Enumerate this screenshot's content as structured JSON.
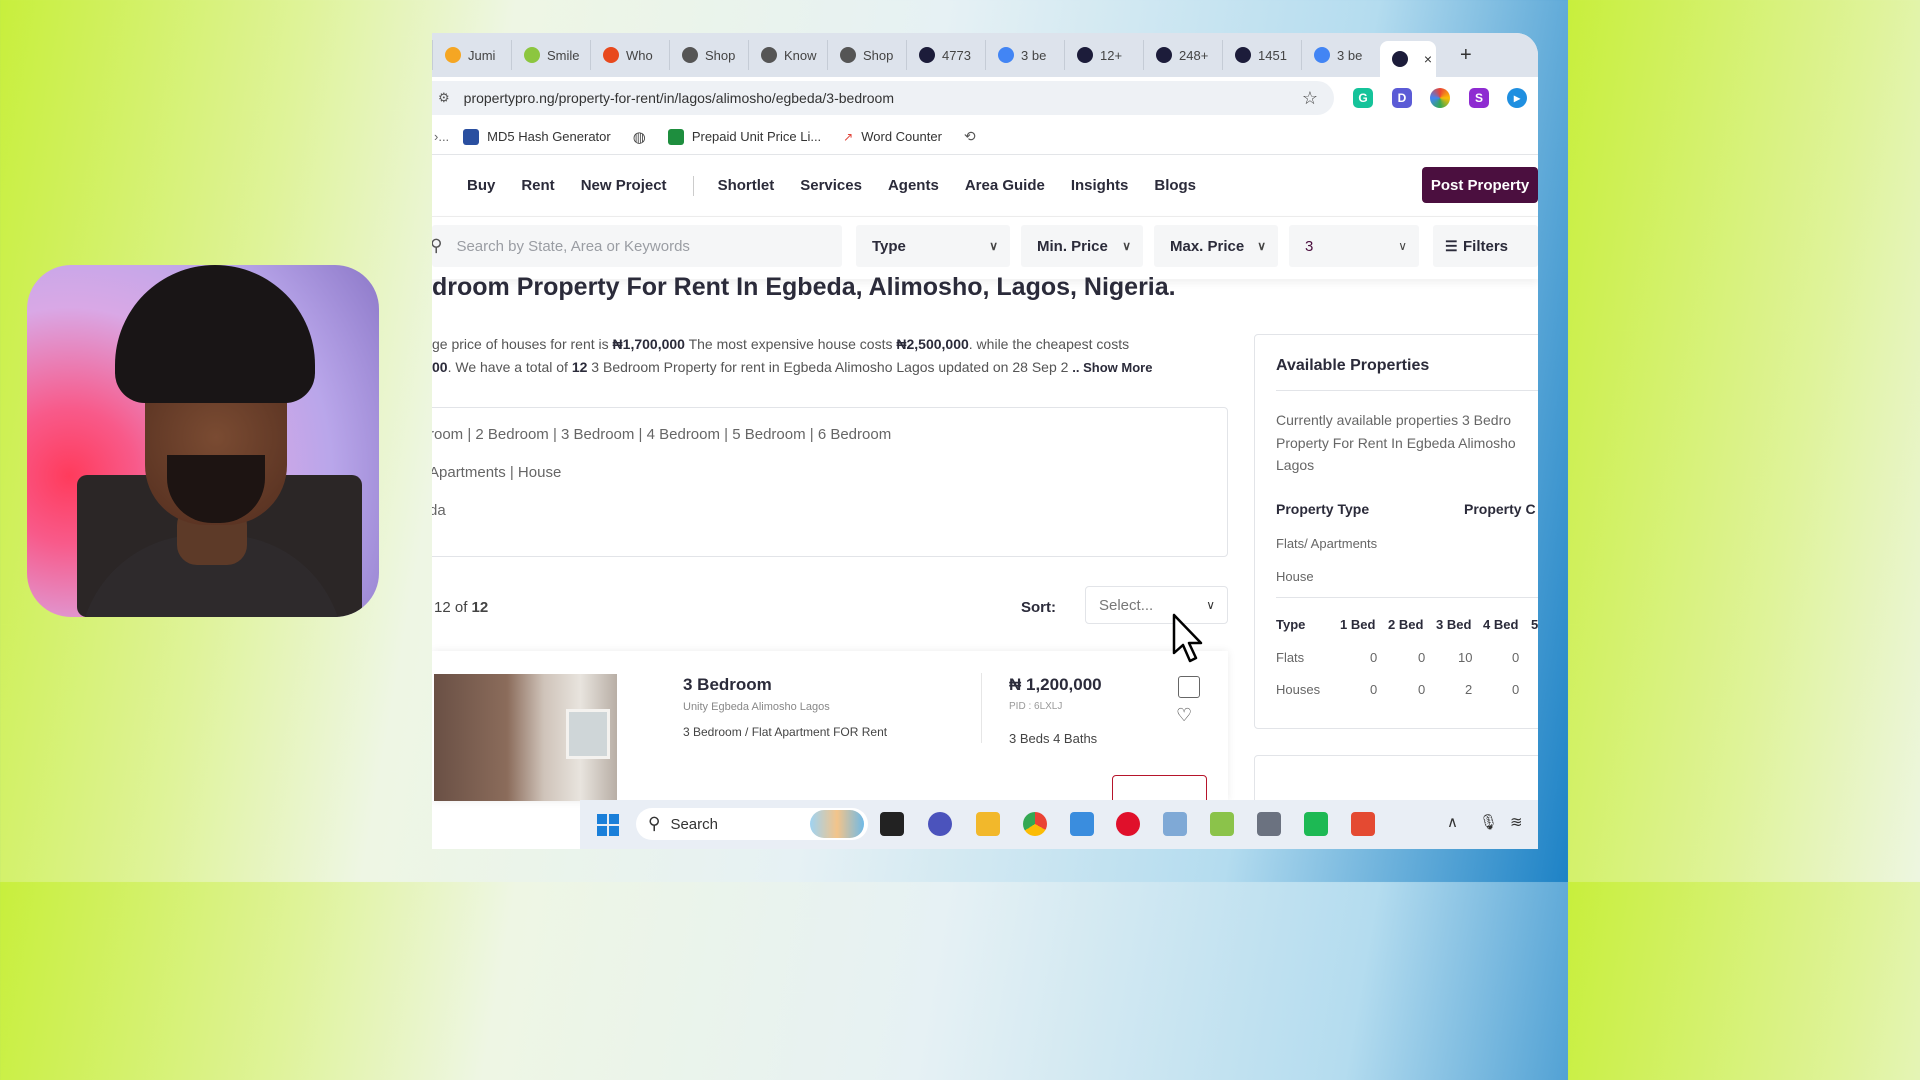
{
  "browser": {
    "tabs": [
      {
        "label": "Jumi",
        "color": "#f5a623"
      },
      {
        "label": "Smile",
        "color": "#8cc63f"
      },
      {
        "label": "Who",
        "color": "#e8491d"
      },
      {
        "label": "Shop",
        "color": "#555555"
      },
      {
        "label": "Know",
        "color": "#555555"
      },
      {
        "label": "Shop",
        "color": "#555555"
      },
      {
        "label": "4773",
        "color": "#1c1c3a"
      },
      {
        "label": "3 be",
        "color": "#4285f4"
      },
      {
        "label": "12+",
        "color": "#1c1c3a"
      },
      {
        "label": "248+",
        "color": "#1c1c3a"
      },
      {
        "label": "1451",
        "color": "#1c1c3a"
      },
      {
        "label": "3 be",
        "color": "#4285f4"
      }
    ],
    "active_tab_close": "×",
    "new_tab": "+",
    "url": "propertypro.ng/property-for-rent/in/lagos/alimosho/egbeda/3-bedroom",
    "bookmarks": [
      {
        "label": "MD5 Hash Generator"
      },
      {
        "label": "Prepaid Unit Price Li..."
      },
      {
        "label": "Word Counter"
      }
    ]
  },
  "nav": {
    "links": [
      "Buy",
      "Rent",
      "New Project"
    ],
    "links2": [
      "Shortlet",
      "Services",
      "Agents",
      "Area Guide",
      "Insights",
      "Blogs"
    ],
    "post_property": "Post Property"
  },
  "search": {
    "placeholder": "Search by State, Area or Keywords",
    "type": "Type",
    "min_price": "Min. Price",
    "max_price": "Max. Price",
    "bedrooms": "3",
    "filters": "Filters"
  },
  "page": {
    "heading": "droom Property For Rent In Egbeda, Alimosho, Lagos, Nigeria.",
    "desc1_a": "ge price of houses for rent is ",
    "avg_price": "₦1,700,000",
    "desc1_b": " The most expensive house costs ",
    "max_price": "₦2,500,000",
    "desc1_c": ". while the cheapest costs",
    "desc2_a": "00",
    "desc2_b": ". We have a total of ",
    "total": "12",
    "desc2_c": " 3 Bedroom Property for rent in Egbeda Alimosho Lagos updated on 28 Sep 2",
    "show_more": ".. Show More",
    "bedroom_links": "room  |  2 Bedroom  |  3 Bedroom  |  4 Bedroom  |  5 Bedroom  |  6 Bedroom",
    "type_links": "Apartments | House",
    "area_link": "da",
    "count_prefix": "12 of ",
    "count_total": "12",
    "sort_label": "Sort:",
    "sort_value": "Select..."
  },
  "listing": {
    "title": "3 Bedroom",
    "location": "Unity Egbeda Alimosho Lagos",
    "description": "3 Bedroom / Flat Apartment FOR Rent",
    "price": "₦ 1,200,000",
    "pid": "PID : 6LXLJ",
    "beds_baths": "3 Beds 4 Baths"
  },
  "sidebar": {
    "title": "Available Properties",
    "text_lines": [
      "Currently available properties 3 Bedro",
      "Property For Rent In Egbeda Alimosho",
      "Lagos"
    ],
    "col_type": "Property Type",
    "col_count": "Property C",
    "types": [
      "Flats/ Apartments",
      "House"
    ],
    "table_headers": [
      "Type",
      "1 Bed",
      "2 Bed",
      "3 Bed",
      "4 Bed",
      "5"
    ],
    "rows": [
      {
        "type": "Flats",
        "values": [
          "0",
          "0",
          "10",
          "0"
        ]
      },
      {
        "type": "Houses",
        "values": [
          "0",
          "0",
          "2",
          "0"
        ]
      }
    ]
  },
  "taskbar": {
    "search": "Search"
  }
}
